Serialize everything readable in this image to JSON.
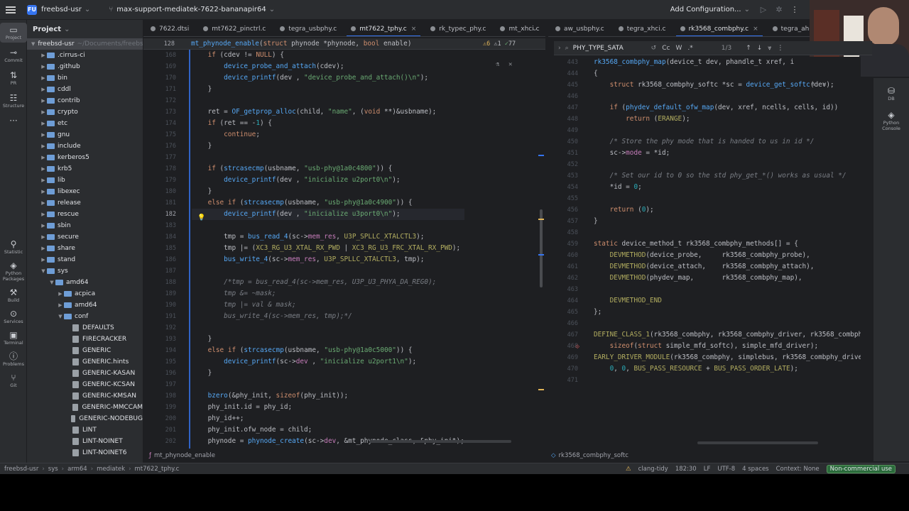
{
  "topbar": {
    "project_badge": "FU",
    "project_name": "freebsd-usr",
    "branch": "max-support-mediatek-7622-bananapir64",
    "run_config": "Add Configuration..."
  },
  "left_strip": [
    {
      "icon": "folder-icon",
      "label": "Project"
    },
    {
      "icon": "commit-icon",
      "label": "Commit"
    },
    {
      "icon": "pull-request-icon",
      "label": "PR"
    },
    {
      "icon": "structure-icon",
      "label": "Structure"
    },
    {
      "icon": "more-icon",
      "label": ""
    },
    {
      "icon": "statistic-icon",
      "label": "Statistic"
    },
    {
      "icon": "python-packages-icon",
      "label": "Python Packages"
    },
    {
      "icon": "build-icon",
      "label": "Build"
    },
    {
      "icon": "services-icon",
      "label": "Services"
    },
    {
      "icon": "terminal-icon",
      "label": "Terminal"
    },
    {
      "icon": "problems-icon",
      "label": "Problems"
    },
    {
      "icon": "git-icon",
      "label": "Git"
    }
  ],
  "right_strip": [
    {
      "icon": "database-icon",
      "label": "DB"
    },
    {
      "icon": "python-console-icon",
      "label": "Python Console"
    }
  ],
  "project_panel": {
    "title": "Project",
    "root": "freebsd-usr",
    "root_path": "~/Documents/freebsd",
    "items": [
      {
        "type": "folder",
        "name": ".cirrus-ci",
        "depth": 1
      },
      {
        "type": "folder",
        "name": ".github",
        "depth": 1
      },
      {
        "type": "folder",
        "name": "bin",
        "depth": 1
      },
      {
        "type": "folder",
        "name": "cddl",
        "depth": 1
      },
      {
        "type": "folder",
        "name": "contrib",
        "depth": 1
      },
      {
        "type": "folder",
        "name": "crypto",
        "depth": 1
      },
      {
        "type": "folder",
        "name": "etc",
        "depth": 1
      },
      {
        "type": "folder",
        "name": "gnu",
        "depth": 1
      },
      {
        "type": "folder",
        "name": "include",
        "depth": 1
      },
      {
        "type": "folder",
        "name": "kerberos5",
        "depth": 1
      },
      {
        "type": "folder",
        "name": "krb5",
        "depth": 1
      },
      {
        "type": "folder",
        "name": "lib",
        "depth": 1
      },
      {
        "type": "folder",
        "name": "libexec",
        "depth": 1
      },
      {
        "type": "folder",
        "name": "release",
        "depth": 1
      },
      {
        "type": "folder",
        "name": "rescue",
        "depth": 1
      },
      {
        "type": "folder",
        "name": "sbin",
        "depth": 1
      },
      {
        "type": "folder",
        "name": "secure",
        "depth": 1
      },
      {
        "type": "folder",
        "name": "share",
        "depth": 1
      },
      {
        "type": "folder",
        "name": "stand",
        "depth": 1
      },
      {
        "type": "folder",
        "name": "sys",
        "depth": 1,
        "open": true
      },
      {
        "type": "folder",
        "name": "amd64",
        "depth": 2,
        "open": true
      },
      {
        "type": "folder",
        "name": "acpica",
        "depth": 3
      },
      {
        "type": "folder",
        "name": "amd64",
        "depth": 3
      },
      {
        "type": "folder",
        "name": "conf",
        "depth": 3,
        "open": true
      },
      {
        "type": "file",
        "name": "DEFAULTS",
        "depth": 4
      },
      {
        "type": "file",
        "name": "FIRECRACKER",
        "depth": 4
      },
      {
        "type": "file",
        "name": "GENERIC",
        "depth": 4
      },
      {
        "type": "file",
        "name": "GENERIC.hints",
        "depth": 4
      },
      {
        "type": "file",
        "name": "GENERIC-KASAN",
        "depth": 4
      },
      {
        "type": "file",
        "name": "GENERIC-KCSAN",
        "depth": 4
      },
      {
        "type": "file",
        "name": "GENERIC-KMSAN",
        "depth": 4
      },
      {
        "type": "file",
        "name": "GENERIC-MMCCAM",
        "depth": 4
      },
      {
        "type": "file",
        "name": "GENERIC-NODEBUG",
        "depth": 4
      },
      {
        "type": "file",
        "name": "LINT",
        "depth": 4
      },
      {
        "type": "file",
        "name": "LINT-NOINET",
        "depth": 4
      },
      {
        "type": "file",
        "name": "LINT-NOINET6",
        "depth": 4
      }
    ]
  },
  "left_tabs": [
    "7622.dtsi",
    "mt7622_pinctrl.c",
    "tegra_usbphy.c",
    "mt7622_tphy.c",
    "rk_typec_phy.c",
    "mt_xhci.c"
  ],
  "left_active_tab": "mt7622_tphy.c",
  "right_tabs": [
    "aw_usbphy.c",
    "tegra_xhci.c",
    "rk3568_combphy.c",
    "tegra_ahci.c"
  ],
  "right_active_tab": "rk3568_combphy.c",
  "left_editor": {
    "sticky_line": "128",
    "sticky_code": "mt_phynode_enable(struct phynode *phynode, bool enable)",
    "inspection": {
      "warnings": "6",
      "weak": "1",
      "typos": "77"
    },
    "lines": [
      {
        "n": "168",
        "code": "if (cdev != NULL) {",
        "indent": 2
      },
      {
        "n": "169",
        "code": "device_probe_and_attach(cdev);",
        "indent": 3
      },
      {
        "n": "170",
        "code": "device_printf(dev , \"device_probe_and_attach()\\n\");",
        "indent": 3
      },
      {
        "n": "171",
        "code": "}",
        "indent": 2
      },
      {
        "n": "172",
        "code": "",
        "indent": 0
      },
      {
        "n": "173",
        "code": "ret = OF_getprop_alloc(child, \"name\", (void **)&usbname);",
        "indent": 2
      },
      {
        "n": "174",
        "code": "if (ret == -1) {",
        "indent": 2
      },
      {
        "n": "175",
        "code": "continue;",
        "indent": 3
      },
      {
        "n": "176",
        "code": "}",
        "indent": 2
      },
      {
        "n": "177",
        "code": "",
        "indent": 0
      },
      {
        "n": "178",
        "code": "if (strcasecmp(usbname, \"usb-phy@1a0c4800\")) {",
        "indent": 2
      },
      {
        "n": "179",
        "code": "device_printf(dev , \"inicialize u2port0\\n\");",
        "indent": 3
      },
      {
        "n": "180",
        "code": "}",
        "indent": 2
      },
      {
        "n": "181",
        "code": "else if (strcasecmp(usbname, \"usb-phy@1a0c4900\")) {",
        "indent": 2
      },
      {
        "n": "182",
        "code": "device_printf(dev , \"inicialize u3port0\\n\");",
        "indent": 3
      },
      {
        "n": "183",
        "code": "",
        "indent": 0
      },
      {
        "n": "184",
        "code": "tmp = bus_read_4(sc->mem_res, U3P_SPLLC_XTALCTL3);",
        "indent": 3
      },
      {
        "n": "185",
        "code": "tmp |= (XC3_RG_U3_XTAL_RX_PWD | XC3_RG_U3_FRC_XTAL_RX_PWD);",
        "indent": 3
      },
      {
        "n": "186",
        "code": "bus_write_4(sc->mem_res, U3P_SPLLC_XTALCTL3, tmp);",
        "indent": 3
      },
      {
        "n": "187",
        "code": "",
        "indent": 0
      },
      {
        "n": "188",
        "code": "/*tmp = bus_read_4(sc->mem_res, U3P_U3_PHYA_DA_REG0);",
        "indent": 3
      },
      {
        "n": "189",
        "code": "tmp &= ~mask;",
        "indent": 3
      },
      {
        "n": "190",
        "code": "tmp |= val & mask;",
        "indent": 3
      },
      {
        "n": "191",
        "code": "bus_write_4(sc->mem_res, tmp);*/",
        "indent": 3
      },
      {
        "n": "192",
        "code": "",
        "indent": 0
      },
      {
        "n": "193",
        "code": "}",
        "indent": 2
      },
      {
        "n": "194",
        "code": "else if (strcasecmp(usbname, \"usb-phy@1a0c5000\")) {",
        "indent": 2
      },
      {
        "n": "195",
        "code": "device_printf(sc->dev , \"inicialize u2port1\\n\");",
        "indent": 3
      },
      {
        "n": "196",
        "code": "}",
        "indent": 2
      },
      {
        "n": "197",
        "code": "",
        "indent": 0
      },
      {
        "n": "198",
        "code": "bzero(&phy_init, sizeof(phy_init));",
        "indent": 2
      },
      {
        "n": "199",
        "code": "phy_init.id = phy_id;",
        "indent": 2
      },
      {
        "n": "200",
        "code": "phy_id++;",
        "indent": 2
      },
      {
        "n": "201",
        "code": "phy_init.ofw_node = child;",
        "indent": 2
      },
      {
        "n": "202",
        "code": "phynode = phynode_create(sc->dev, &mt_phynode_class, &phy_init);",
        "indent": 2
      }
    ]
  },
  "find": {
    "query": "PHY_TYPE_SATA",
    "match_case": "Cc",
    "words": "W",
    "regex": ".*",
    "count": "1/3"
  },
  "right_editor": {
    "lines": [
      {
        "n": "443",
        "code": "rk3568_combphy_map(device_t dev, phandle_t xref, i"
      },
      {
        "n": "444",
        "code": "{"
      },
      {
        "n": "445",
        "code": "    struct rk3568_combphy_softc *sc = device_get_softc(dev);"
      },
      {
        "n": "446",
        "code": ""
      },
      {
        "n": "447",
        "code": "    if (phydev_default_ofw_map(dev, xref, ncells, cells, id))"
      },
      {
        "n": "448",
        "code": "        return (ERANGE);"
      },
      {
        "n": "449",
        "code": ""
      },
      {
        "n": "450",
        "code": "    /* Store the phy mode that is handed to us in id */"
      },
      {
        "n": "451",
        "code": "    sc->mode = *id;"
      },
      {
        "n": "452",
        "code": ""
      },
      {
        "n": "453",
        "code": "    /* Set our id to 0 so the std phy_get_*() works as usual */"
      },
      {
        "n": "454",
        "code": "    *id = 0;"
      },
      {
        "n": "455",
        "code": ""
      },
      {
        "n": "456",
        "code": "    return (0);"
      },
      {
        "n": "457",
        "code": "}"
      },
      {
        "n": "458",
        "code": ""
      },
      {
        "n": "459",
        "code": "static device_method_t rk3568_combphy_methods[] = {"
      },
      {
        "n": "460",
        "code": "    DEVMETHOD(device_probe,     rk3568_combphy_probe),"
      },
      {
        "n": "461",
        "code": "    DEVMETHOD(device_attach,    rk3568_combphy_attach),"
      },
      {
        "n": "462",
        "code": "    DEVMETHOD(phydev_map,       rk3568_combphy_map),"
      },
      {
        "n": "463",
        "code": ""
      },
      {
        "n": "464",
        "code": "    DEVMETHOD_END"
      },
      {
        "n": "465",
        "code": "};"
      },
      {
        "n": "466",
        "code": ""
      },
      {
        "n": "467",
        "code": "DEFINE_CLASS_1(rk3568_combphy, rk3568_combphy_driver, rk3568_combphy_me"
      },
      {
        "n": "468",
        "code": "    sizeof(struct simple_mfd_softc), simple_mfd_driver);"
      },
      {
        "n": "469",
        "code": "EARLY_DRIVER_MODULE(rk3568_combphy, simplebus, rk3568_combphy_driver,"
      },
      {
        "n": "470",
        "code": "    0, 0, BUS_PASS_RESOURCE + BUS_PASS_ORDER_LATE);"
      },
      {
        "n": "471",
        "code": ""
      }
    ]
  },
  "crumbs": {
    "left": "mt_phynode_enable",
    "right": "rk3568_combphy_softc"
  },
  "status": {
    "path": [
      "freebsd-usr",
      "sys",
      "arm64",
      "mediatek",
      "mt7622_tphy.c"
    ],
    "linter": "clang-tidy",
    "position": "182:30",
    "line_sep": "LF",
    "encoding": "UTF-8",
    "indent": "4 spaces",
    "context": "Context: None",
    "license": "Non-commercial use"
  },
  "colors": {
    "accent": "#3574f0",
    "bg": "#1e1f22",
    "panel": "#2b2d30"
  }
}
